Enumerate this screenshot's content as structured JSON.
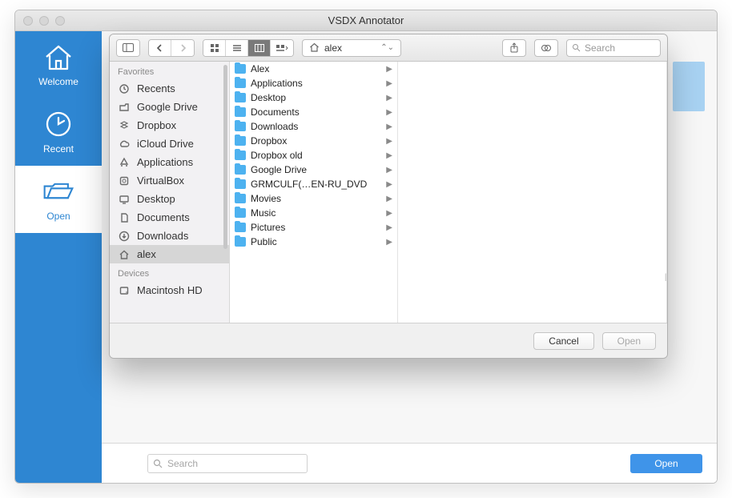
{
  "window": {
    "title": "VSDX Annotator"
  },
  "sidebar_nav": [
    {
      "key": "welcome",
      "label": "Welcome",
      "icon": "home-icon"
    },
    {
      "key": "recent",
      "label": "Recent",
      "icon": "clock-icon"
    },
    {
      "key": "open",
      "label": "Open",
      "icon": "folder-open-icon",
      "selected": true
    }
  ],
  "bottom": {
    "search_placeholder": "Search",
    "open_label": "Open"
  },
  "dialog": {
    "path_label": "alex",
    "search_placeholder": "Search",
    "buttons": {
      "cancel": "Cancel",
      "open": "Open"
    },
    "sidebar": {
      "group1_title": "Favorites",
      "group2_title": "Devices",
      "favorites": [
        {
          "label": "Recents",
          "icon": "recents-icon"
        },
        {
          "label": "Google Drive",
          "icon": "gdrive-icon"
        },
        {
          "label": "Dropbox",
          "icon": "dropbox-icon"
        },
        {
          "label": "iCloud Drive",
          "icon": "cloud-icon"
        },
        {
          "label": "Applications",
          "icon": "apps-icon"
        },
        {
          "label": "VirtualBox",
          "icon": "disk-icon"
        },
        {
          "label": "Desktop",
          "icon": "desktop-icon"
        },
        {
          "label": "Documents",
          "icon": "documents-icon"
        },
        {
          "label": "Downloads",
          "icon": "downloads-icon"
        },
        {
          "label": "alex",
          "icon": "house-icon",
          "selected": true
        }
      ],
      "devices": [
        {
          "label": "Macintosh HD",
          "icon": "hdd-icon"
        }
      ]
    },
    "column_items": [
      {
        "label": "Alex"
      },
      {
        "label": "Applications"
      },
      {
        "label": "Desktop"
      },
      {
        "label": "Documents"
      },
      {
        "label": "Downloads"
      },
      {
        "label": "Dropbox"
      },
      {
        "label": "Dropbox old"
      },
      {
        "label": "Google Drive"
      },
      {
        "label": "GRMCULF(…EN-RU_DVD"
      },
      {
        "label": "Movies"
      },
      {
        "label": "Music"
      },
      {
        "label": "Pictures"
      },
      {
        "label": "Public"
      }
    ]
  }
}
